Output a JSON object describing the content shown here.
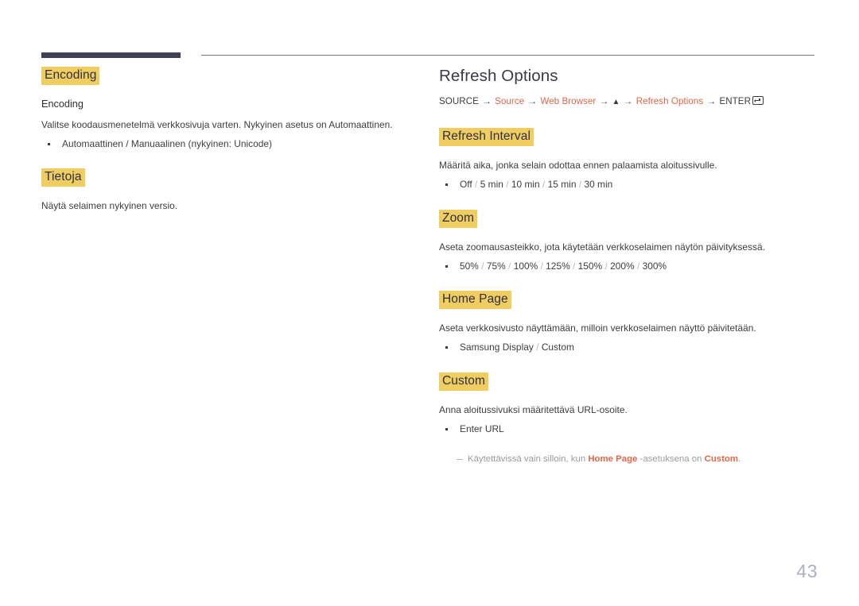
{
  "page": {
    "number": "43",
    "accent_highlight": "#f0cd61",
    "accent_link": "#e0664a",
    "rule_dark": "#3f3f56",
    "text_color": "#3c3c3c"
  },
  "left_column": {
    "sections": [
      {
        "highlight_title": "Encoding",
        "subheading": "Encoding",
        "paragraph": "Valitse koodausmenetelmä verkkosivuja varten. Nykyinen asetus on Automaattinen.",
        "bullets": [
          {
            "text": "Automaattinen / Manuaalinen (nykyinen: Unicode)",
            "style": "plain"
          }
        ]
      },
      {
        "highlight_title": "Tietoja",
        "paragraph": "Näytä selaimen nykyinen versio.",
        "bullets": []
      }
    ]
  },
  "right_column": {
    "title": "Refresh Options",
    "breadcrumb": {
      "items": [
        {
          "label": "SOURCE",
          "kind": "plain"
        },
        {
          "label": "Source",
          "kind": "link"
        },
        {
          "label": "Web Browser",
          "kind": "link"
        },
        {
          "label": "▲",
          "kind": "up"
        },
        {
          "label": "Refresh Options",
          "kind": "link"
        },
        {
          "label": "ENTER",
          "kind": "plain"
        }
      ],
      "separator": "→",
      "enter_icon": "enter-key-icon"
    },
    "sections": [
      {
        "highlight_title": "Refresh Interval",
        "paragraph": "Määritä aika, jonka selain odottaa ennen palaamista aloitussivulle.",
        "options": [
          "Off",
          "5 min",
          "10 min",
          "15 min",
          "30 min"
        ]
      },
      {
        "highlight_title": "Zoom",
        "paragraph": "Aseta zoomausasteikko, jota käytetään verkkoselaimen näytön päivityksessä.",
        "options": [
          "50%",
          "75%",
          "100%",
          "125%",
          "150%",
          "200%",
          "300%"
        ]
      },
      {
        "highlight_title": "Home Page",
        "paragraph": "Aseta verkkosivusto näyttämään, milloin verkkoselaimen näyttö päivitetään.",
        "options": [
          "Samsung Display",
          "Custom"
        ]
      },
      {
        "highlight_title": "Custom",
        "paragraph": "Anna aloitussivuksi määritettävä URL-osoite.",
        "options": [
          "Enter URL"
        ],
        "note": {
          "before": "Käytettävissä vain silloin, kun ",
          "key1": "Home Page",
          "middle": " -asetuksena on ",
          "key2": "Custom",
          "after": "."
        }
      }
    ]
  }
}
